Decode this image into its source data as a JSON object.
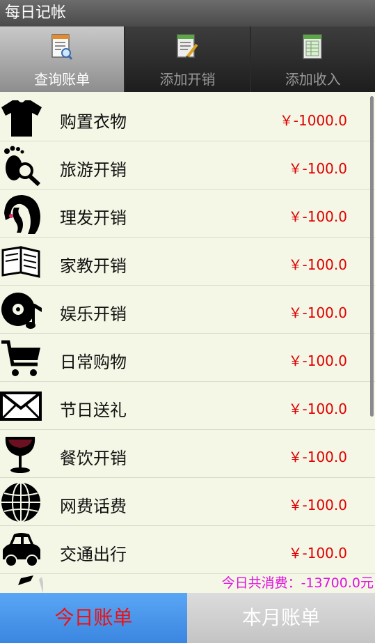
{
  "app": {
    "title": "每日记帐"
  },
  "tabs": [
    {
      "label": "查询账单",
      "icon": "query-document-icon",
      "active": true
    },
    {
      "label": "添加开销",
      "icon": "edit-document-icon",
      "active": false
    },
    {
      "label": "添加收入",
      "icon": "spreadsheet-document-icon",
      "active": false
    }
  ],
  "expenses": [
    {
      "name": "购置衣物",
      "amount": "￥-1000.0",
      "icon": "tshirt-icon"
    },
    {
      "name": "旅游开销",
      "amount": "￥-100.0",
      "icon": "footprint-search-icon"
    },
    {
      "name": "理发开销",
      "amount": "￥-100.0",
      "icon": "hair-icon"
    },
    {
      "name": "家教开销",
      "amount": "￥-100.0",
      "icon": "book-icon"
    },
    {
      "name": "娱乐开销",
      "amount": "￥-100.0",
      "icon": "music-disc-icon"
    },
    {
      "name": "日常购物",
      "amount": "￥-100.0",
      "icon": "shopping-cart-icon"
    },
    {
      "name": "节日送礼",
      "amount": "￥-100.0",
      "icon": "envelope-icon"
    },
    {
      "name": "餐饮开销",
      "amount": "￥-100.0",
      "icon": "wine-glass-icon"
    },
    {
      "name": "网费话费",
      "amount": "￥-100.0",
      "icon": "globe-icon"
    },
    {
      "name": "交通出行",
      "amount": "￥-100.0",
      "icon": "car-icon"
    }
  ],
  "summary": {
    "total_label": "今日共消费：-13700.0元"
  },
  "bottom": {
    "today_label": "今日账单",
    "month_label": "本月账单"
  },
  "colors": {
    "amount": "#e00000",
    "total": "#e010e0",
    "today_text": "#ee1111",
    "today_bg": "#4a96ea",
    "background": "#f4f7e6"
  }
}
